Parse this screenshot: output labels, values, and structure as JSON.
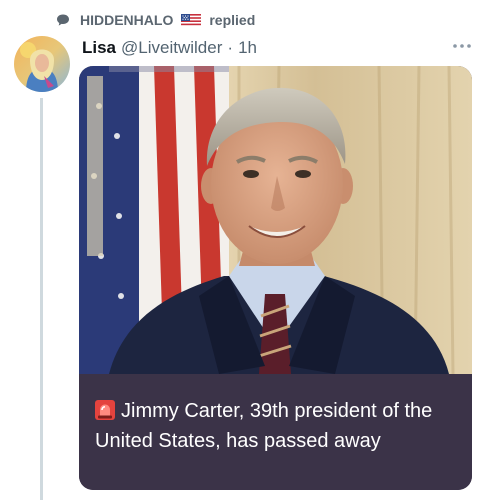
{
  "context": {
    "icon": "speech-bubble-icon",
    "name": "HIDDENHALO",
    "flag": "us-flag-icon",
    "action": "replied"
  },
  "tweet": {
    "author": "Lisa",
    "handle": "@Liveitwilder",
    "separator": "·",
    "time": "1h",
    "more_icon": "more-dots-icon"
  },
  "media": {
    "caption": "Jimmy Carter, 39th president of the United States, has passed away",
    "caption_icon": "siren-emoji-icon"
  },
  "colors": {
    "context_text": "#5b6670",
    "handle": "#536471",
    "caption_bg": "#3b3348",
    "thread_line": "#cfd9de"
  }
}
